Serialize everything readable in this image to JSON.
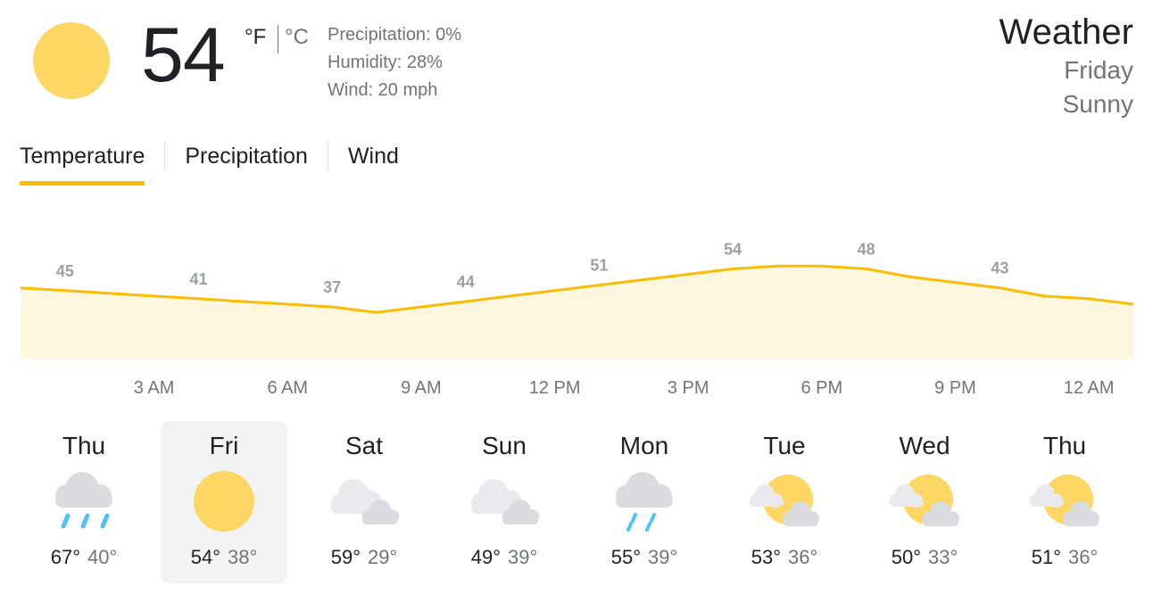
{
  "current": {
    "temperature": "54",
    "unit_f": "°F",
    "unit_c": "°C",
    "precipitation": "Precipitation: 0%",
    "humidity": "Humidity: 28%",
    "wind": "Wind: 20 mph",
    "icon": "sun-icon"
  },
  "header": {
    "title": "Weather",
    "day": "Friday",
    "condition": "Sunny"
  },
  "tabs": [
    {
      "label": "Temperature",
      "active": true
    },
    {
      "label": "Precipitation",
      "active": false
    },
    {
      "label": "Wind",
      "active": false
    }
  ],
  "colors": {
    "accent": "#fbbc04",
    "chart_fill": "#fef7e0",
    "sun": "#fdd663",
    "cloud": "#dadce0",
    "rain": "#4fc3f7"
  },
  "chart_data": {
    "type": "area",
    "x": [
      "12 AM",
      "1 AM",
      "2 AM",
      "3 AM",
      "4 AM",
      "5 AM",
      "6 AM",
      "7 AM",
      "8 AM",
      "9 AM",
      "10 AM",
      "11 AM",
      "12 PM",
      "1 PM",
      "2 PM",
      "3 PM",
      "4 PM",
      "5 PM",
      "6 PM",
      "7 PM",
      "8 PM",
      "9 PM",
      "10 PM",
      "11 PM",
      "12 AM",
      "1 AM"
    ],
    "values": [
      46,
      45,
      44,
      43,
      42,
      41,
      40,
      39,
      37,
      39,
      41,
      43,
      45,
      47,
      49,
      51,
      53,
      54,
      54,
      53,
      50,
      48,
      46,
      43,
      42,
      40
    ],
    "labels": [
      {
        "x": "1 AM",
        "value": "45"
      },
      {
        "x": "4 AM",
        "value": "41"
      },
      {
        "x": "7 AM",
        "value": "37"
      },
      {
        "x": "10 AM",
        "value": "44"
      },
      {
        "x": "1 PM",
        "value": "51"
      },
      {
        "x": "4 PM",
        "value": "54"
      },
      {
        "x": "7 PM",
        "value": "48"
      },
      {
        "x": "10 PM",
        "value": "43"
      }
    ],
    "tick_labels": [
      "3 AM",
      "6 AM",
      "9 AM",
      "12 PM",
      "3 PM",
      "6 PM",
      "9 PM",
      "12 AM"
    ],
    "ylim": [
      20,
      60
    ]
  },
  "forecast": [
    {
      "day": "Thu",
      "icon": "rain-icon",
      "high": "67°",
      "low": "40°",
      "selected": false
    },
    {
      "day": "Fri",
      "icon": "sun-icon",
      "high": "54°",
      "low": "38°",
      "selected": true
    },
    {
      "day": "Sat",
      "icon": "cloudy-icon",
      "high": "59°",
      "low": "29°",
      "selected": false
    },
    {
      "day": "Sun",
      "icon": "cloudy-icon",
      "high": "49°",
      "low": "39°",
      "selected": false
    },
    {
      "day": "Mon",
      "icon": "light-rain-icon",
      "high": "55°",
      "low": "39°",
      "selected": false
    },
    {
      "day": "Tue",
      "icon": "partly-cloudy-icon",
      "high": "53°",
      "low": "36°",
      "selected": false
    },
    {
      "day": "Wed",
      "icon": "partly-cloudy-icon",
      "high": "50°",
      "low": "33°",
      "selected": false
    },
    {
      "day": "Thu",
      "icon": "partly-cloudy-icon",
      "high": "51°",
      "low": "36°",
      "selected": false
    }
  ]
}
